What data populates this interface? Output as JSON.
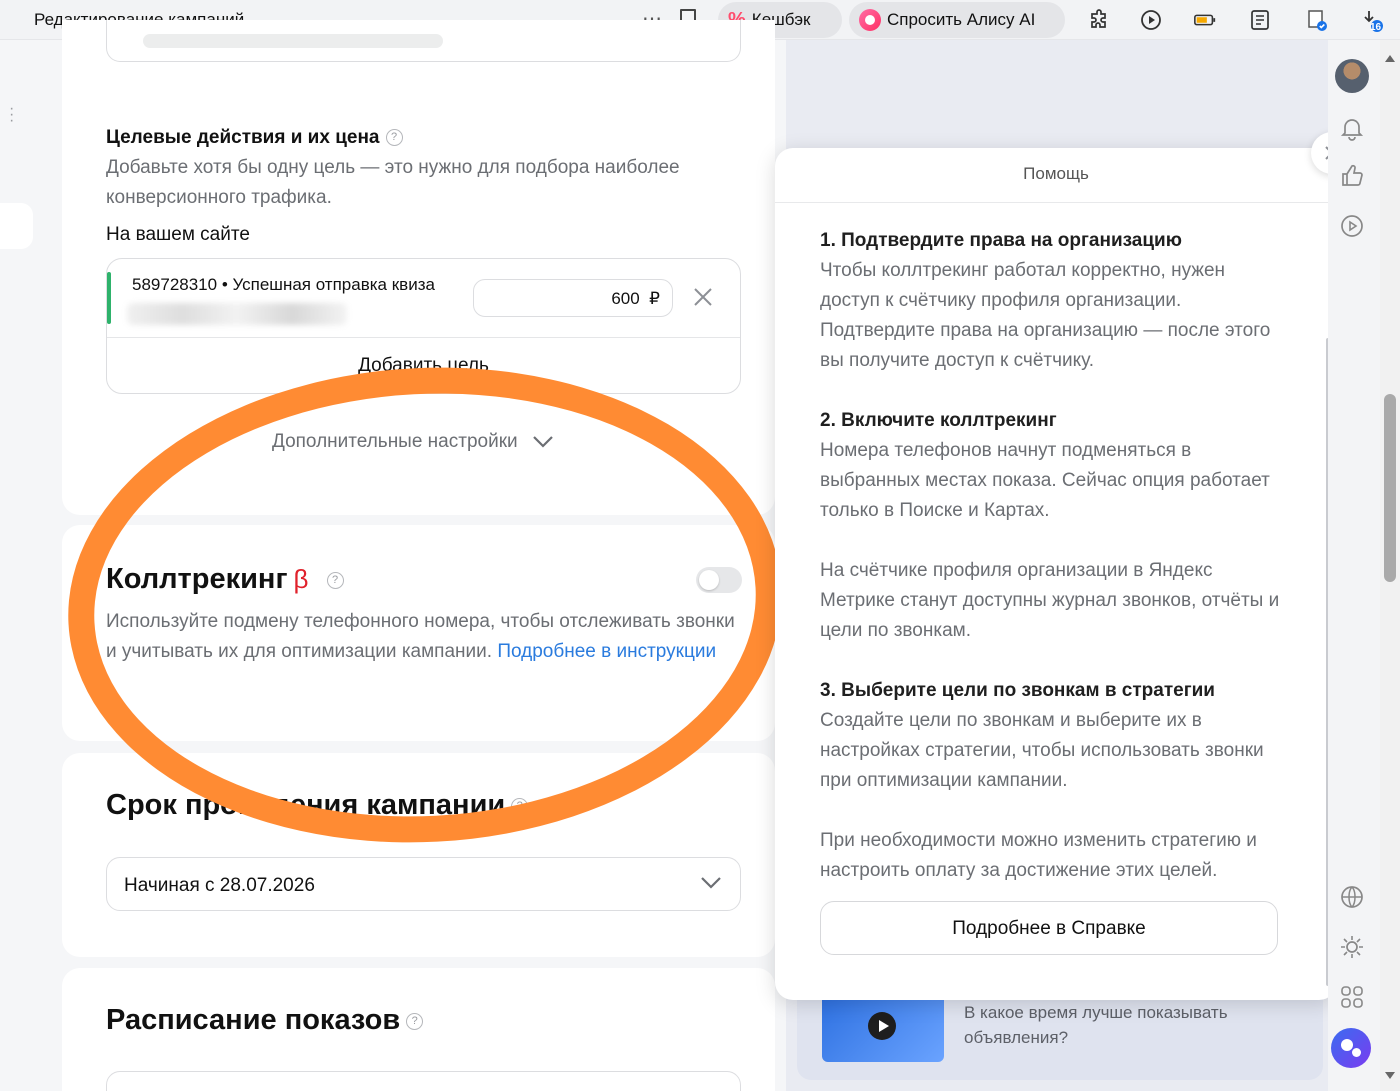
{
  "browser": {
    "tab_title": "Редактирование кампаний",
    "cashback_label": "Кешбэк",
    "alice_label": "Спросить Алису AI",
    "downloads_badge": "16"
  },
  "goals_section": {
    "title": "Целевые действия и их цена",
    "description": "Добавьте хотя бы одну цель — это нужно для подбора наиболее конверсионного трафика.",
    "on_site_label": "На вашем сайте",
    "goal": {
      "name": "589728310 • Успешная отправка квиза",
      "price": "600",
      "currency": "₽"
    },
    "add_goal_label": "Добавить цель",
    "more_settings_label": "Дополнительные настройки"
  },
  "calltracking": {
    "title": "Коллтрекинг",
    "beta": "β",
    "text": "Используйте подмену телефонного номера, чтобы отслеживать звонки и учитывать их для оптимизации кампании.",
    "link": "Подробнее в инструкции",
    "toggle_state": "off"
  },
  "campaign_period": {
    "title": "Срок проведения кампании",
    "value": "Начиная с 28.07.2026"
  },
  "schedule": {
    "title": "Расписание показов"
  },
  "help_panel": {
    "title": "Помощь",
    "steps": [
      {
        "title": "1. Подтвердите права на организацию",
        "text": "Чтобы коллтрекинг работал корректно, нужен доступ к счётчику профиля организации. Подтвердите права на организацию — после этого вы получите доступ к счётчику."
      },
      {
        "title": "2. Включите коллтрекинг",
        "text": "Номера телефонов начнут подменяться в выбранных местах показа. Сейчас опция работает только в Поиске и Картах.",
        "note": "На счётчике профиля организации в Яндекс Метрике станут доступны журнал звонков, отчёты и цели по звонкам."
      },
      {
        "title": "3. Выберите цели по звонкам в стратегии",
        "text": "Создайте цели по звонкам и выберите их в настройках стратегии, чтобы использовать звонки при оптимизации кампании.",
        "note": "При необходимости можно изменить стратегию и настроить оплату за достижение этих целей."
      }
    ],
    "button_label": "Подробнее в Справке"
  },
  "video_card": {
    "text": "В какое время лучше показывать объявления?"
  },
  "colors": {
    "accent_link": "#2a7bde",
    "annotation": "#ff8b33",
    "beta": "#e0212b",
    "goal_status": "#2eb26b"
  }
}
